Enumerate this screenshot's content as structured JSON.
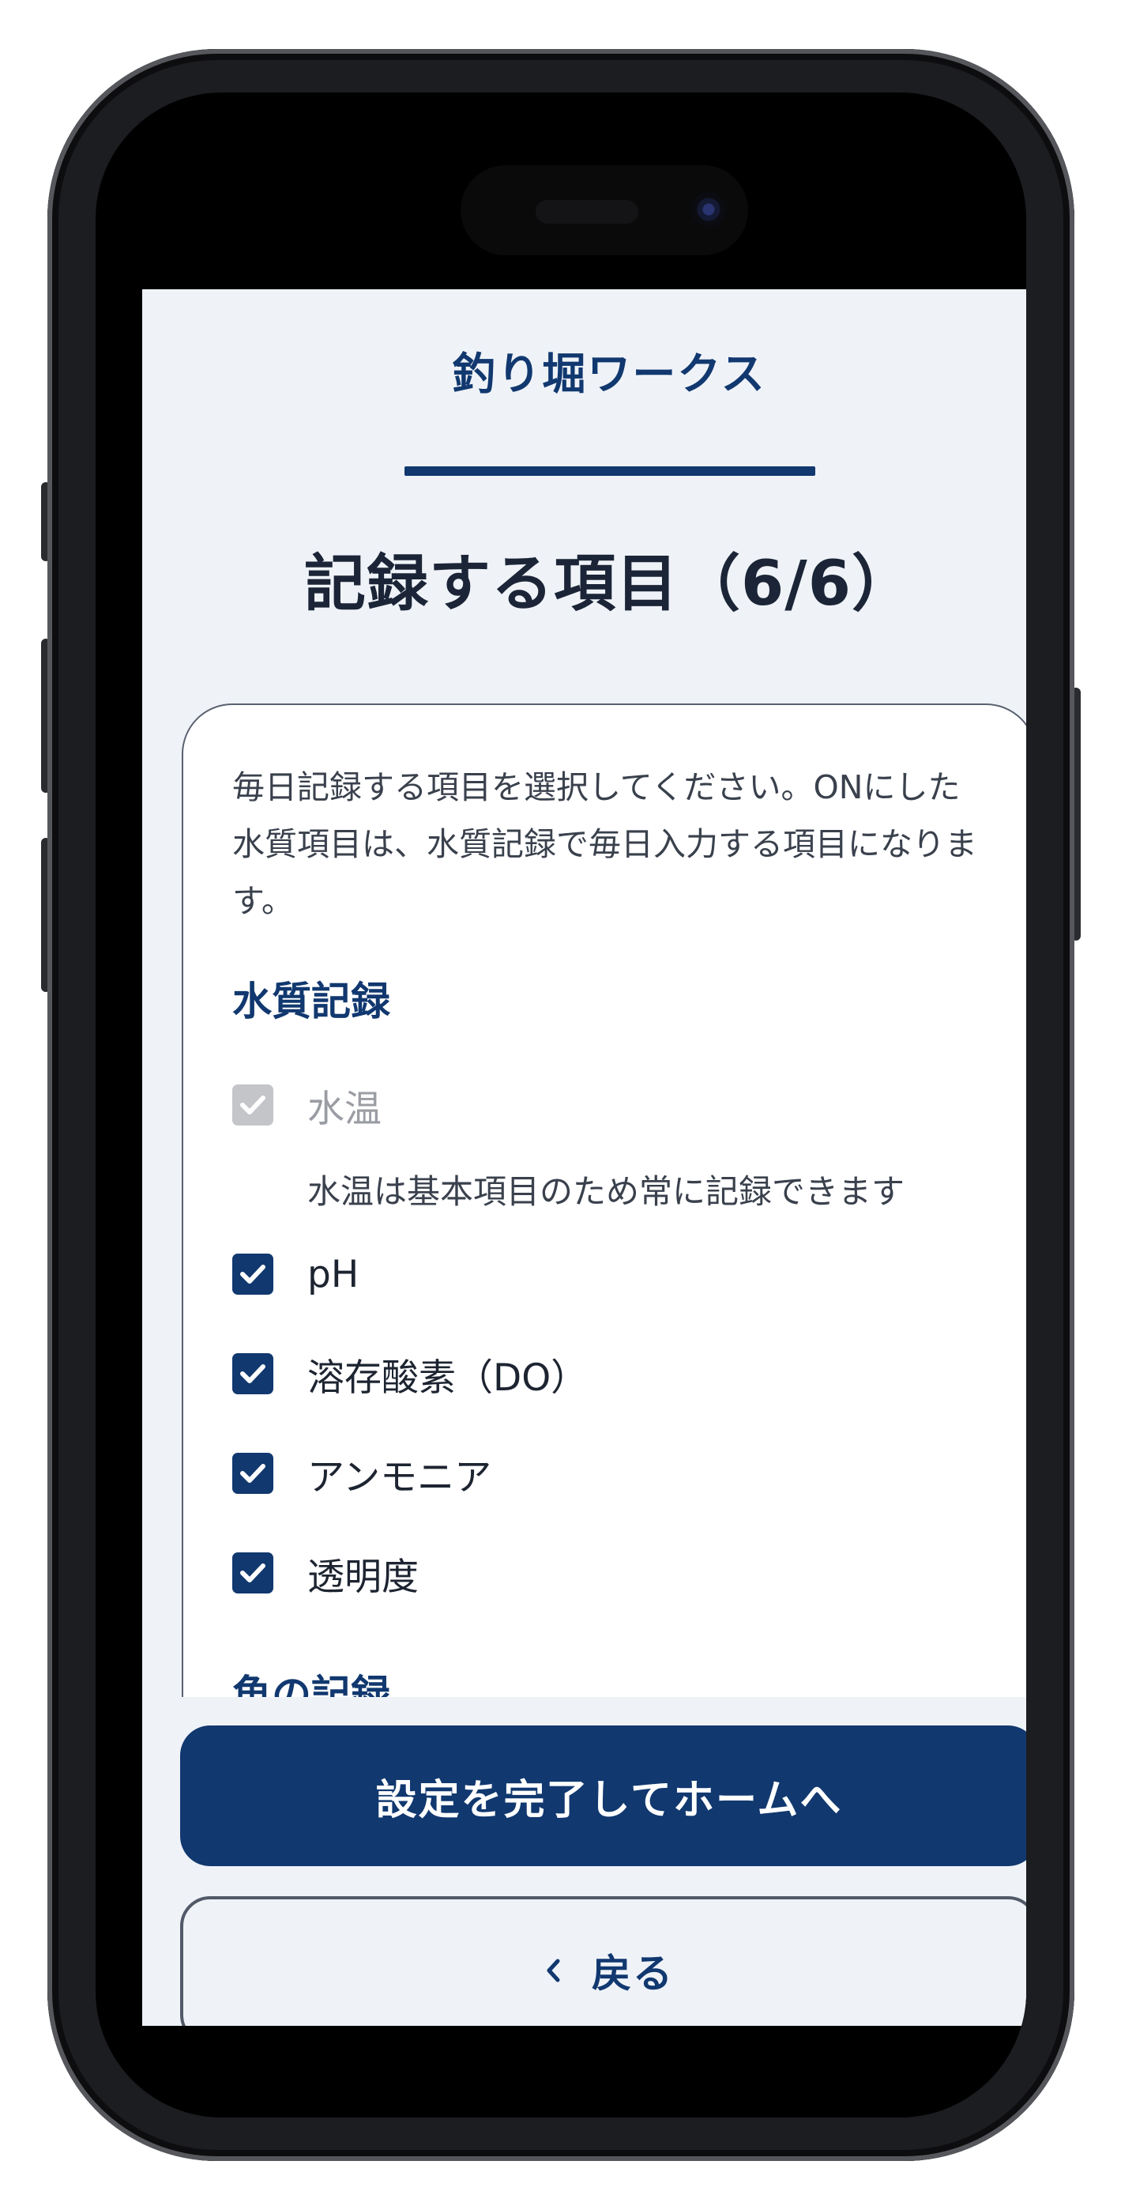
{
  "app": {
    "brand": "釣り堀ワークス"
  },
  "progress": {
    "current_step": 6,
    "total_steps": 6,
    "fraction": 1.0
  },
  "page": {
    "title": "記録する項目（6/6）"
  },
  "card": {
    "intro": "毎日記録する項目を選択してください。ONにした水質項目は、水質記録で毎日入力する項目になります。",
    "water_section": {
      "title": "水質記録",
      "fixed_item": {
        "label": "水温",
        "checked": true,
        "disabled": true,
        "note": "水温は基本項目のため常に記録できます"
      },
      "items": [
        {
          "label": "pH",
          "checked": true
        },
        {
          "label": "溶存酸素（DO）",
          "checked": true
        },
        {
          "label": "アンモニア",
          "checked": true
        },
        {
          "label": "透明度",
          "checked": true
        }
      ]
    },
    "next_section": {
      "title": "魚の記録"
    }
  },
  "actions": {
    "complete_label": "設定を完了してホームへ",
    "back_label": "戻る"
  },
  "colors": {
    "primary": "#11386f",
    "background": "#eff3f8",
    "disabled": "#c3c5c9"
  }
}
